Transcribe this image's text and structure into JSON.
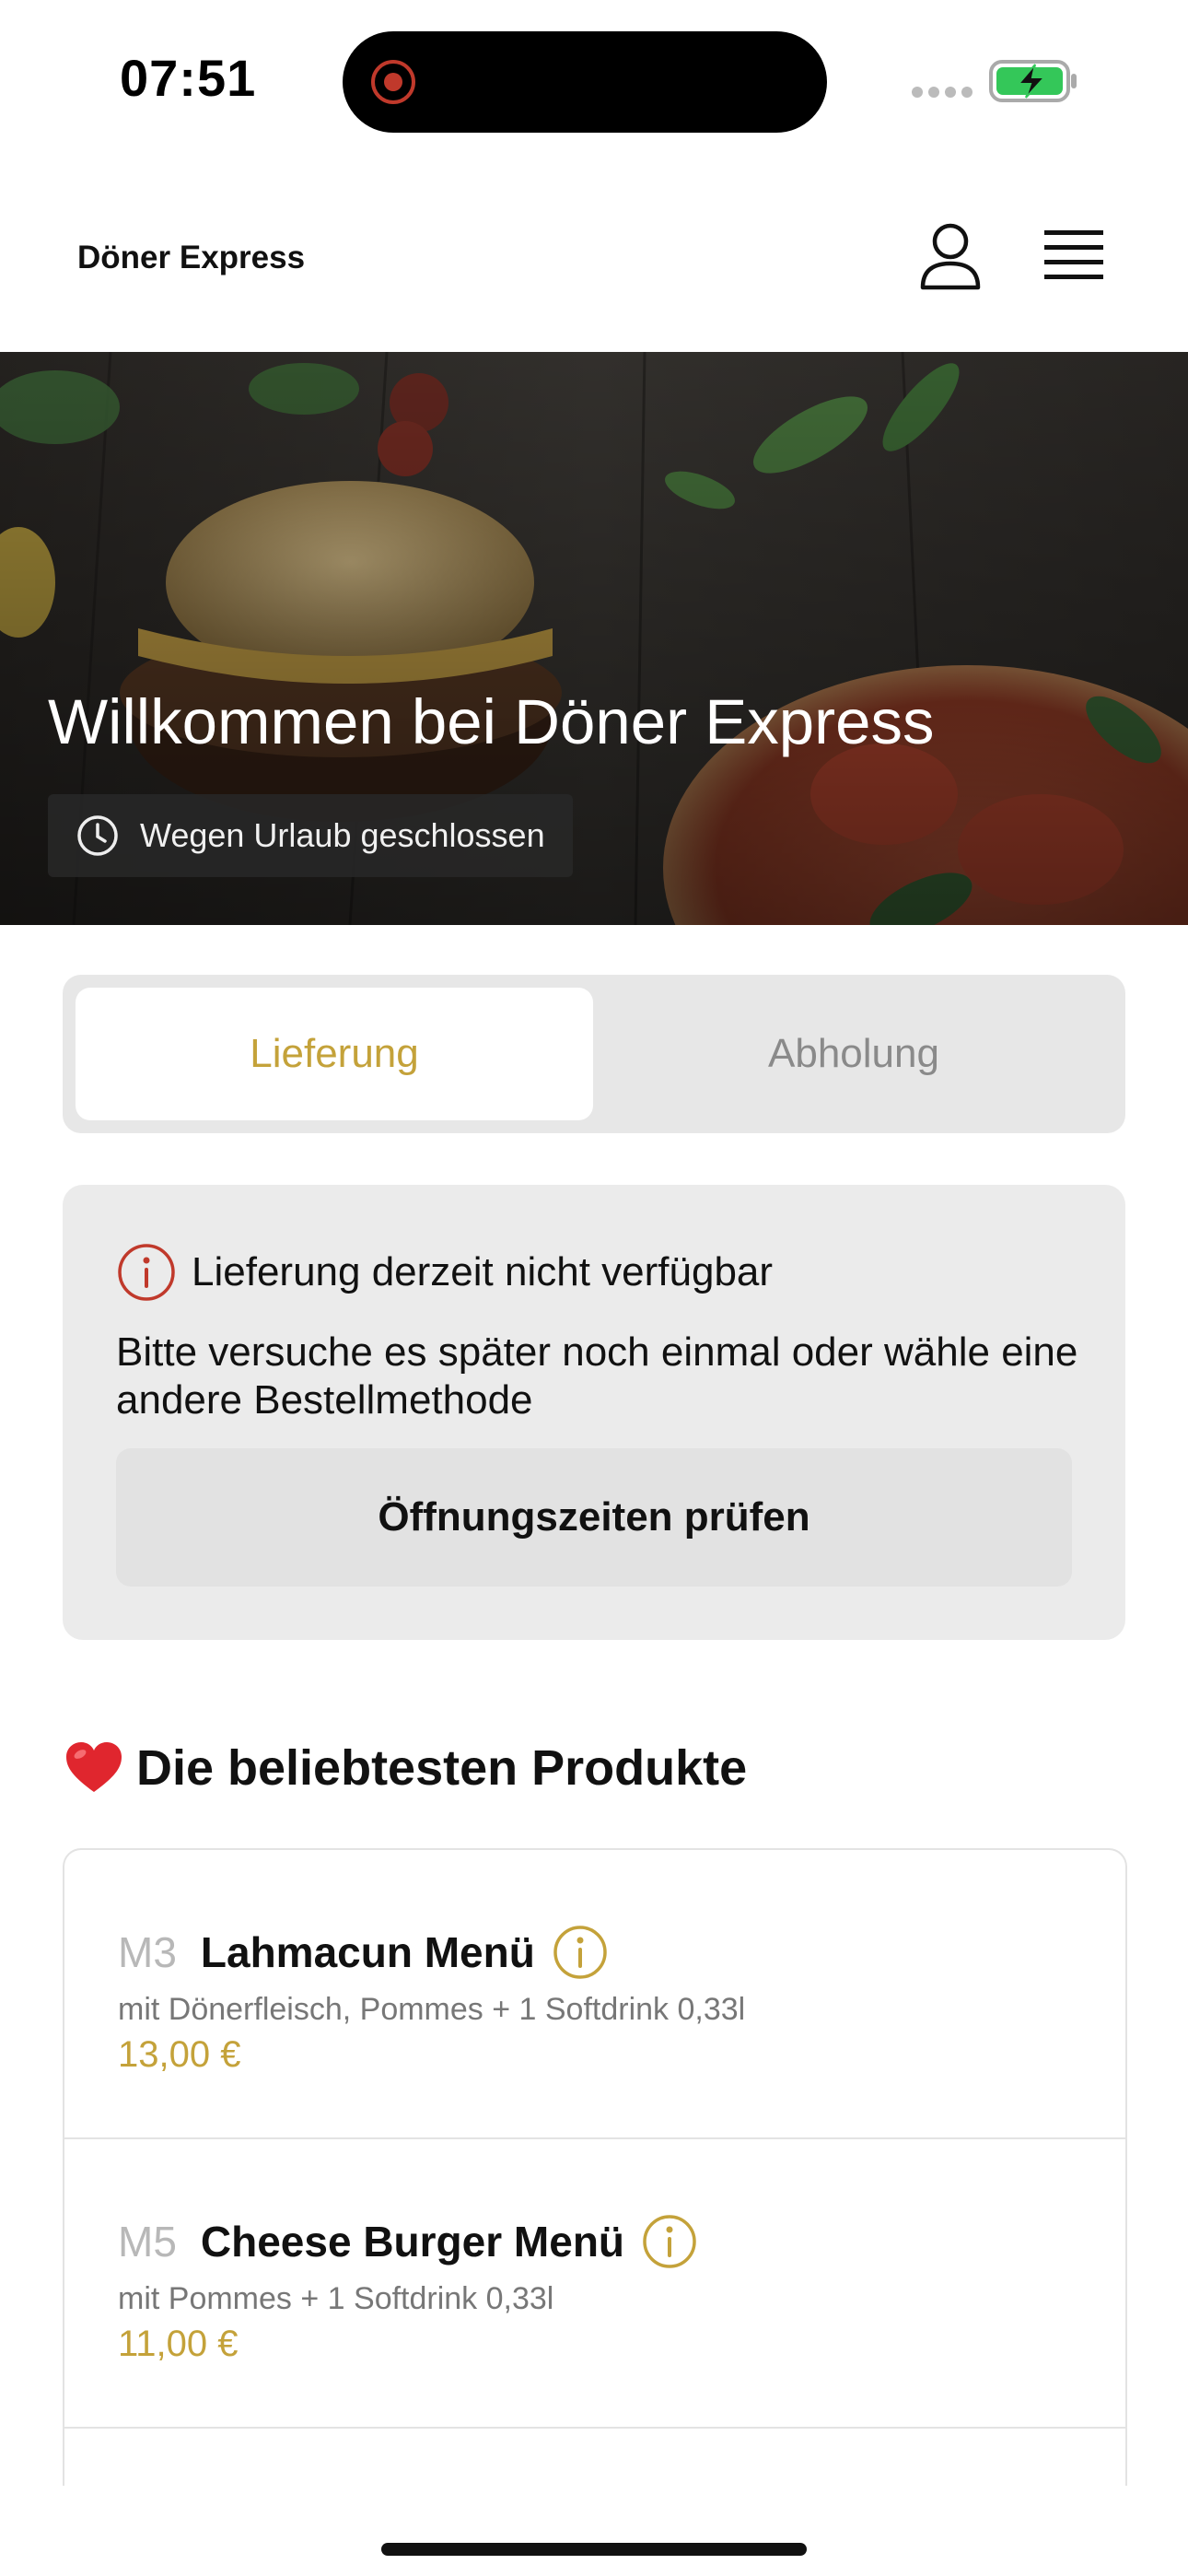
{
  "status_bar": {
    "time": "07:51"
  },
  "header": {
    "brand": "Döner Express"
  },
  "hero": {
    "title": "Willkommen bei Döner Express",
    "status": "Wegen Urlaub geschlossen"
  },
  "order_mode": {
    "options": [
      "Lieferung",
      "Abholung"
    ],
    "selected": "Lieferung"
  },
  "notice": {
    "title": "Lieferung derzeit nicht verfügbar",
    "text": "Bitte versuche es später noch einmal oder wähle eine andere Bestellmethode",
    "button": "Öffnungszeiten prüfen"
  },
  "popular": {
    "title": "Die beliebtesten Produkte",
    "items": [
      {
        "code": "M3",
        "name": "Lahmacun Menü",
        "description": "mit Dönerfleisch, Pommes + 1 Softdrink 0,33l",
        "price": "13,00 €"
      },
      {
        "code": "M5",
        "name": "Cheese Burger Menü",
        "description": "mit Pommes + 1 Softdrink 0,33l",
        "price": "11,00 €"
      }
    ]
  },
  "colors": {
    "accent": "#c4a23a",
    "alert": "#c0392b",
    "battery": "#34c759"
  }
}
